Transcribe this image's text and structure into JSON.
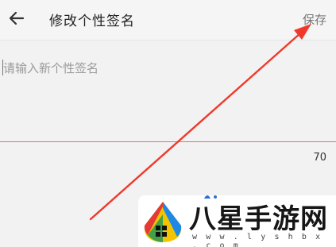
{
  "header": {
    "back_icon": "arrow-left-icon",
    "title": "修改个性签名",
    "save_label": "保存"
  },
  "editor": {
    "placeholder": "请输入新个性签名",
    "value": "",
    "remaining_count": "70",
    "underline_color": "#e26b8a"
  },
  "annotation": {
    "type": "red-arrow",
    "points_to": "save-button",
    "color": "#f0392b"
  },
  "watermark": {
    "brand": "八星手游网",
    "url": "w w w . l y s h b x . c o m"
  }
}
